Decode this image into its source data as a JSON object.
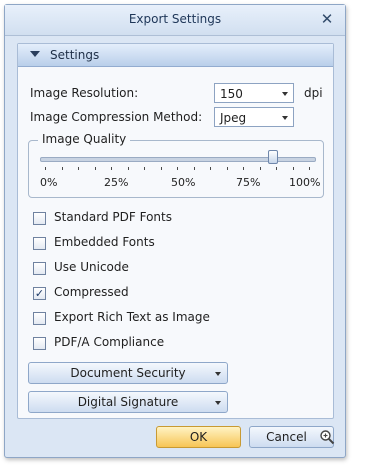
{
  "window": {
    "title": "Export Settings"
  },
  "section": {
    "label": "Settings"
  },
  "resolution": {
    "label": "Image Resolution:",
    "value": "150",
    "unit": "dpi"
  },
  "compression": {
    "label": "Image Compression Method:",
    "value": "Jpeg"
  },
  "quality": {
    "label": "Image Quality",
    "ticks": [
      "0%",
      "25%",
      "50%",
      "75%",
      "100%"
    ],
    "value_percent": 85
  },
  "options": [
    {
      "label": "Standard PDF Fonts",
      "checked": false
    },
    {
      "label": "Embedded Fonts",
      "checked": false
    },
    {
      "label": "Use Unicode",
      "checked": false
    },
    {
      "label": "Compressed",
      "checked": true
    },
    {
      "label": "Export Rich Text as Image",
      "checked": false
    },
    {
      "label": "PDF/A Compliance",
      "checked": false
    }
  ],
  "buttons": {
    "document_security": "Document Security",
    "digital_signature": "Digital Signature",
    "ok": "OK",
    "cancel": "Cancel"
  }
}
